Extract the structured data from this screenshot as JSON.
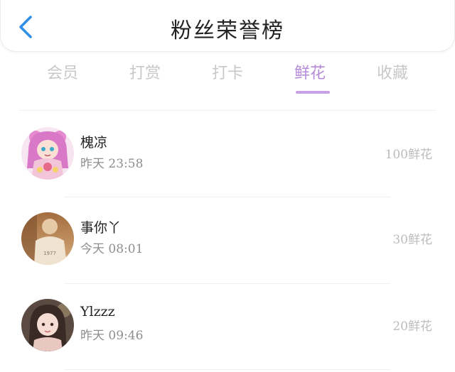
{
  "header": {
    "title": "粉丝荣誉榜"
  },
  "tabs": [
    {
      "label": "会员",
      "active": false
    },
    {
      "label": "打赏",
      "active": false
    },
    {
      "label": "打卡",
      "active": false
    },
    {
      "label": "鲜花",
      "active": true
    },
    {
      "label": "收藏",
      "active": false
    }
  ],
  "ranking": [
    {
      "name": "槐凉",
      "time": "昨天 23:58",
      "amount": "100鲜花"
    },
    {
      "name": "事你丫",
      "time": "今天 08:01",
      "amount": "30鲜花"
    },
    {
      "name": "Ylzzz",
      "time": "昨天 09:46",
      "amount": "20鲜花"
    }
  ],
  "colors": {
    "accent": "#b78ad8",
    "back_icon": "#2f8fe8"
  },
  "icons": {
    "back": "chevron-left-icon"
  }
}
